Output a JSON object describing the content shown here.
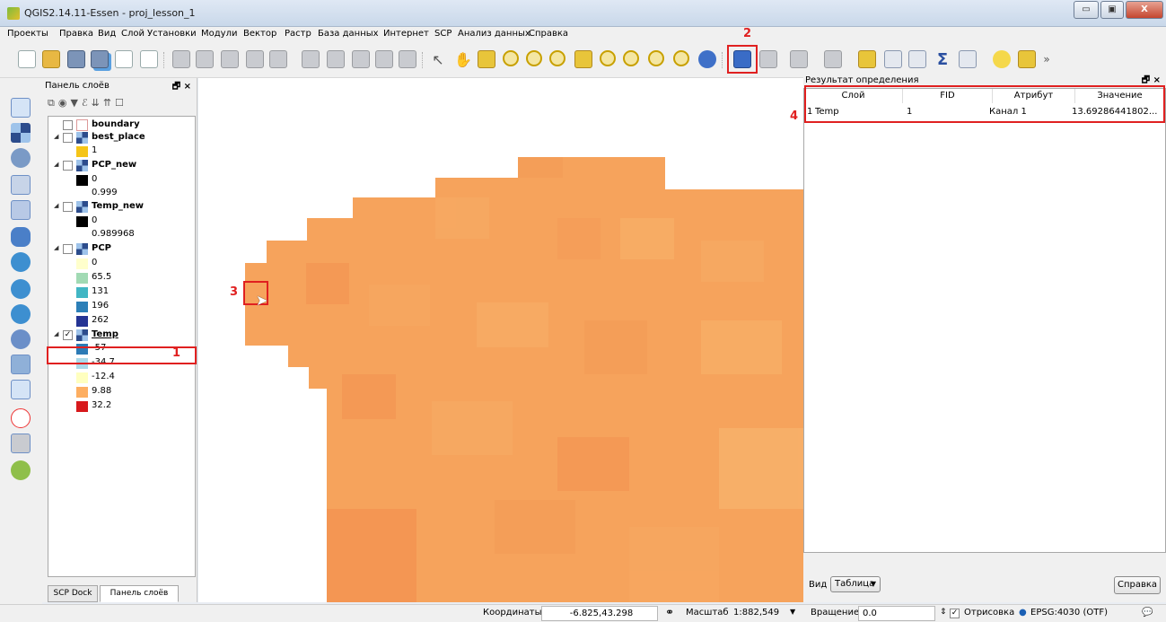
{
  "window": {
    "title": "QGIS2.14.11-Essen - proj_lesson_1",
    "min": "▭",
    "max": "▣",
    "close": "X"
  },
  "menu": [
    "Проекты",
    "Правка",
    "Вид",
    "Слой",
    "Установки",
    "Модули",
    "Вектор",
    "Растр",
    "База данных",
    "Интернет",
    "SCP",
    "Анализ данных",
    "Справка"
  ],
  "annotations": {
    "n1": "1",
    "n2": "2",
    "n3": "3",
    "n4": "4"
  },
  "layers_panel": {
    "title": "Панель слоёв",
    "controls": "🗗 ×",
    "layers": [
      {
        "name": "boundary",
        "checked": false,
        "expanded": false,
        "icon": "polygon-icon"
      },
      {
        "name": "best_place",
        "checked": false,
        "expanded": true,
        "icon": "raster-icon",
        "legend": [
          {
            "label": "1",
            "color": "#f5c518"
          }
        ]
      },
      {
        "name": "PCP_new",
        "checked": false,
        "expanded": true,
        "icon": "raster-icon",
        "legend": [
          {
            "label": "0",
            "color": "#000000"
          },
          {
            "label": "0.999",
            "color": null
          }
        ]
      },
      {
        "name": "Temp_new",
        "checked": false,
        "expanded": true,
        "icon": "raster-icon",
        "legend": [
          {
            "label": "0",
            "color": "#000000"
          },
          {
            "label": "0.989968",
            "color": null
          }
        ]
      },
      {
        "name": "PCP",
        "checked": false,
        "expanded": true,
        "icon": "raster-icon",
        "legend": [
          {
            "label": "0",
            "color": "#ffffcc"
          },
          {
            "label": "65.5",
            "color": "#a1dab4"
          },
          {
            "label": "131",
            "color": "#41b6c4"
          },
          {
            "label": "196",
            "color": "#2c7fb8"
          },
          {
            "label": "262",
            "color": "#253494"
          }
        ]
      },
      {
        "name": "Temp",
        "checked": true,
        "expanded": true,
        "icon": "raster-icon",
        "selected": true,
        "legend": [
          {
            "label": "-57",
            "color": "#2c7bb6"
          },
          {
            "label": "-34.7",
            "color": "#abd9e9"
          },
          {
            "label": "-12.4",
            "color": "#ffffbf"
          },
          {
            "label": "9.88",
            "color": "#fdae61"
          },
          {
            "label": "32.2",
            "color": "#d7191c"
          }
        ]
      }
    ],
    "tabs": [
      "SCP Dock",
      "Панель слоёв"
    ]
  },
  "identify_panel": {
    "title": "Результат определения",
    "controls": "🗗 ×",
    "columns": [
      "Слой",
      "FID",
      "Атрибут",
      "Значение"
    ],
    "rows": [
      {
        "num": "1",
        "layer": "Temp",
        "fid": "1",
        "attribute": "Канал 1",
        "value": "13.69286441802..."
      }
    ],
    "view_label": "Вид",
    "view_value": "Таблица",
    "help_button": "Справка"
  },
  "status_bar": {
    "coord_label": "Координаты",
    "coord_value": "-6.825,43.298",
    "scale_label": "Масштаб",
    "scale_value": "1:882,549",
    "rotation_label": "Вращение",
    "rotation_value": "0.0",
    "render_label": "Отрисовка",
    "crs": "EPSG:4030 (OTF)"
  },
  "colors": {
    "accent_red": "#e02020",
    "map_orange": "#f6a35c"
  }
}
